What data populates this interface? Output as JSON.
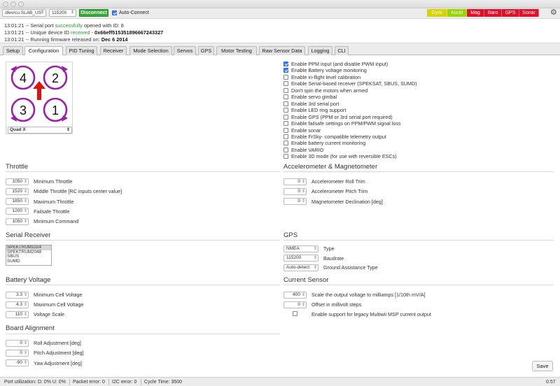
{
  "header": {
    "port": "/dev/cu.SLAB_US",
    "baud": "115200",
    "connect_label": "Disconnect",
    "auto_connect_label": "Auto-Connect",
    "sensors": [
      {
        "label": "Gyro",
        "color": "#d4d400"
      },
      {
        "label": "Accel",
        "color": "#9ad400"
      },
      {
        "label": "Mag",
        "color": "#e0102a"
      },
      {
        "label": "Baro",
        "color": "#e0102a"
      },
      {
        "label": "GPS",
        "color": "#e0102a"
      },
      {
        "label": "Sonar",
        "color": "#e0102a"
      }
    ],
    "settings_icon": "gear-icon"
  },
  "log": {
    "line1_time": "13:01:21 -- Serial port ",
    "line1_green": "successfully",
    "line1_rest": " opened with ID: 8",
    "line2_time": "13:01:21 -- Unique device ID ",
    "line2_green": "received",
    "line2_sep": " - ",
    "line2_bold": "0x66eff515351896667243327",
    "line3_time": "13:01:21 -- Running firmware released on: ",
    "line3_bold": "Dec 6 2014"
  },
  "tabs": [
    "Setup",
    "Configuration",
    "PID Tuning",
    "Receiver",
    "Mode Selection",
    "Servos",
    "GPS",
    "Motor Testing",
    "Raw Sensor Data",
    "Logging",
    "CLI"
  ],
  "active_tab": "Configuration",
  "mixer": {
    "motors": [
      "4",
      "2",
      "3",
      "1"
    ],
    "selected": "Quad X",
    "motor_color": "#9b1fa8",
    "arrow_color": "#e01010"
  },
  "features": [
    {
      "label": "Enable PPM input (and disable PWM input)",
      "checked": true
    },
    {
      "label": "Enable Battery voltage monitoring",
      "checked": true
    },
    {
      "label": "Enable in-flight level calibration",
      "checked": false
    },
    {
      "label": "Enable Serial-based receiver (SPEKSAT, SBUS, SUMD)",
      "checked": false
    },
    {
      "label": "Don't spin the motors when armed",
      "checked": false
    },
    {
      "label": "Enable servo gimbal",
      "checked": false
    },
    {
      "label": "Enable 3rd serial port",
      "checked": false
    },
    {
      "label": "Enable LED ring support",
      "checked": false
    },
    {
      "label": "Enable GPS (PPM or 3rd serial port required)",
      "checked": false
    },
    {
      "label": "Enable failsafe settings on PPM/PWM signal loss",
      "checked": false
    },
    {
      "label": "Enable sonar",
      "checked": false
    },
    {
      "label": "Enable FrSky- compatible telemetry output",
      "checked": false
    },
    {
      "label": "Enable battery current monitoring",
      "checked": false
    },
    {
      "label": "Enable VARIO",
      "checked": false
    },
    {
      "label": "Enable 3D mode (for use with reversible ESCs)",
      "checked": false
    }
  ],
  "throttle": {
    "title": "Throttle",
    "rows": [
      {
        "value": "1050",
        "label": "Minimum Throttle"
      },
      {
        "value": "1520",
        "label": "Middle Throttle [RC inputs center value]"
      },
      {
        "value": "1850",
        "label": "Maximum Throttle"
      },
      {
        "value": "1200",
        "label": "Failsafe Throttle"
      },
      {
        "value": "1050",
        "label": "Minimum Command"
      }
    ]
  },
  "accelerometer": {
    "title": "Accelerometer & Magnetometer",
    "rows": [
      {
        "value": "0",
        "label": "Accelerometer Roll Trim"
      },
      {
        "value": "0",
        "label": "Accelerometer Pitch Trim"
      },
      {
        "value": "0",
        "label": "Magnetometer Declination [deg]"
      }
    ]
  },
  "serial_receiver": {
    "title": "Serial Receiver",
    "options": [
      "SPEKTRUM1024",
      "SPEKTRUM2048",
      "SBUS",
      "SUMD"
    ],
    "selected_index": 0
  },
  "gps": {
    "title": "GPS",
    "rows": [
      {
        "value": "NMEA",
        "label": "Type"
      },
      {
        "value": "115200",
        "label": "Baudrate"
      },
      {
        "value": "Auto-detect",
        "label": "Ground Assistance Type"
      }
    ]
  },
  "battery": {
    "title": "Battery Voltage",
    "rows": [
      {
        "value": "3.3",
        "label": "Minimum Cell Voltage"
      },
      {
        "value": "4.3",
        "label": "Maximum Cell Voltage"
      },
      {
        "value": "110",
        "label": "Voltage Scale"
      }
    ]
  },
  "current": {
    "title": "Current Sensor",
    "rows": [
      {
        "value": "400",
        "label": "Scale the output voltage to milliamps [1/10th mV/A]"
      },
      {
        "value": "0",
        "label": "Offset in millivolt steps"
      }
    ],
    "legacy_label": "Enable support for legacy Multiwii MSP current output",
    "legacy_checked": false
  },
  "board": {
    "title": "Board Alignment",
    "rows": [
      {
        "value": "0",
        "label": "Roll Adjustment [deg]"
      },
      {
        "value": "0",
        "label": "Pitch Adjustment [deg]"
      },
      {
        "value": "-90",
        "label": "Yaw Adjustment [deg]"
      }
    ]
  },
  "save_label": "Save",
  "status": {
    "port_util": "Port utilization: D: 0% U: 0%",
    "packet_error": "Packet error: 0",
    "i2c_error": "I2C error: 0",
    "cycle_time": "Cycle Time: 3500",
    "version": "0.57"
  }
}
